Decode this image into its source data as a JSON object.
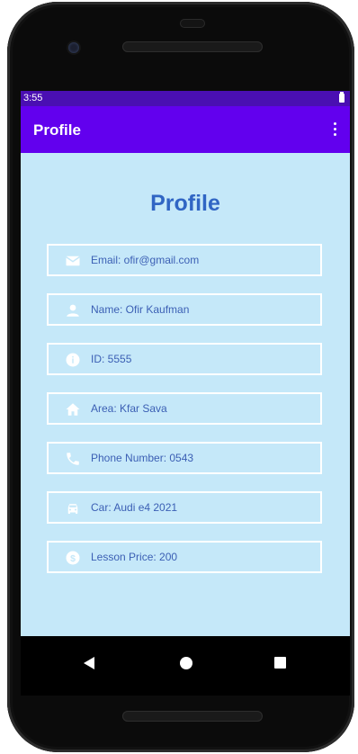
{
  "status_bar": {
    "time": "3:55"
  },
  "app_bar": {
    "title": "Profile",
    "menu_icon": "more-vert-icon"
  },
  "page": {
    "heading": "Profile"
  },
  "profile_fields": [
    {
      "icon": "email-icon",
      "text": "Email: ofir@gmail.com"
    },
    {
      "icon": "person-icon",
      "text": "Name: Ofir Kaufman"
    },
    {
      "icon": "info-icon",
      "text": "ID: 5555"
    },
    {
      "icon": "home-icon",
      "text": "Area: Kfar Sava"
    },
    {
      "icon": "phone-icon",
      "text": "Phone Number: 0543"
    },
    {
      "icon": "car-icon",
      "text": "Car: Audi e4 2021"
    },
    {
      "icon": "dollar-icon",
      "text": "Lesson Price: 200"
    }
  ],
  "nav_bar": {
    "back_icon": "back-icon",
    "home_icon": "home-circle-icon",
    "recents_icon": "recents-icon"
  },
  "colors": {
    "status_bar": "#4a0fb2",
    "app_bar": "#6200ee",
    "content_background": "#c5e8f9",
    "heading_text": "#3065c4",
    "field_text": "#3b5fb4",
    "field_border": "#ffffff"
  }
}
